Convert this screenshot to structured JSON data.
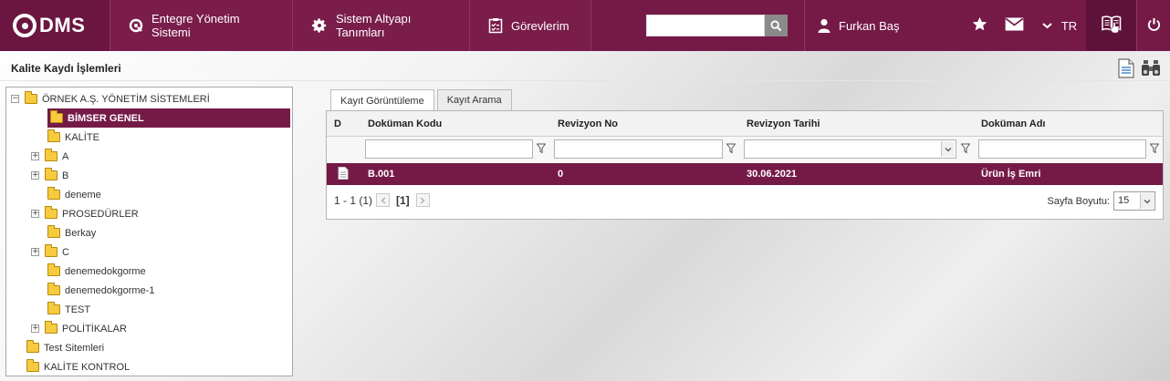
{
  "app": {
    "logo": "DMS",
    "nav": [
      {
        "label": "Entegre Yönetim Sistemi",
        "icon": "q-logo-icon"
      },
      {
        "label": "Sistem Altyapı Tanımları",
        "icon": "gear-icon"
      },
      {
        "label": "Görevlerim",
        "icon": "tasks-clipboard-icon"
      }
    ],
    "search": {
      "value": "",
      "placeholder": ""
    },
    "user": {
      "name": "Furkan Baş",
      "icon": "user-icon"
    },
    "language": "TR"
  },
  "page": {
    "title": "Kalite Kaydı İşlemleri"
  },
  "tree": {
    "items": [
      {
        "label": "ÖRNEK A.Ş. YÖNETİM SİSTEMLERİ",
        "expander": "⊟",
        "selected": false
      },
      {
        "label": "BİMSER GENEL",
        "expander": "",
        "selected": true
      },
      {
        "label": "KALİTE",
        "expander": "",
        "selected": false
      },
      {
        "label": "A",
        "expander": "⊞",
        "selected": false
      },
      {
        "label": "B",
        "expander": "⊞",
        "selected": false
      },
      {
        "label": "deneme",
        "expander": "",
        "selected": false
      },
      {
        "label": "PROSEDÜRLER",
        "expander": "⊞",
        "selected": false
      },
      {
        "label": "Berkay",
        "expander": "",
        "selected": false
      },
      {
        "label": "C",
        "expander": "⊞",
        "selected": false
      },
      {
        "label": "denemedokgorme",
        "expander": "",
        "selected": false
      },
      {
        "label": "denemedokgorme-1",
        "expander": "",
        "selected": false
      },
      {
        "label": "TEST",
        "expander": "",
        "selected": false
      },
      {
        "label": "POLİTİKALAR",
        "expander": "⊞",
        "selected": false
      },
      {
        "label": "Test Sitemleri",
        "expander": "",
        "selected": false
      },
      {
        "label": "KALİTE KONTROL",
        "expander": "",
        "selected": false
      }
    ]
  },
  "tabs": [
    {
      "label": "Kayıt Görüntüleme",
      "active": true
    },
    {
      "label": "Kayıt Arama",
      "active": false
    }
  ],
  "grid": {
    "columns": [
      "D",
      "Doküman Kodu",
      "Revizyon No",
      "Revizyon Tarihi",
      "Doküman Adı"
    ],
    "rows": [
      {
        "code": "B.001",
        "revision": "0",
        "date": "30.06.2021",
        "name": "Ürün İş Emri"
      }
    ],
    "pager": {
      "summary": "1 - 1 (1)",
      "current": "[1]"
    },
    "page_size": {
      "label": "Sayfa Boyutu:",
      "value": "15"
    }
  },
  "colors": {
    "brand": "#751a47",
    "brand_dark": "#5f1239"
  }
}
